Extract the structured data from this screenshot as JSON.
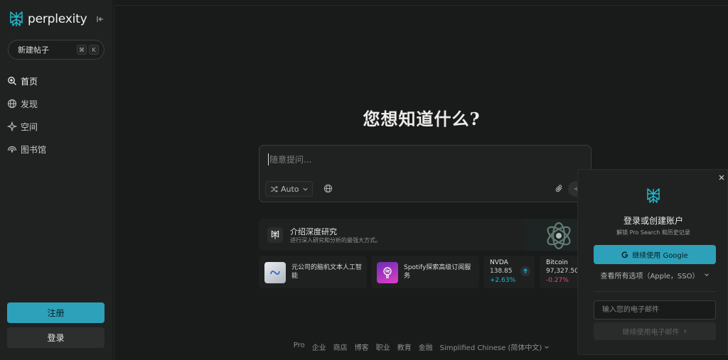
{
  "app": {
    "name": "perplexity"
  },
  "sidebar": {
    "new_thread": {
      "label": "新建帖子",
      "shortcut": [
        "⌘",
        "K"
      ]
    },
    "items": [
      {
        "label": "首页",
        "icon": "search-icon",
        "active": true
      },
      {
        "label": "发现",
        "icon": "globe-icon",
        "active": false
      },
      {
        "label": "空间",
        "icon": "spaces-icon",
        "active": false
      },
      {
        "label": "图书馆",
        "icon": "library-icon",
        "active": false
      }
    ],
    "signup_label": "注册",
    "login_label": "登录"
  },
  "main": {
    "headline": "您想知道什么?",
    "search": {
      "placeholder": "随意提问...",
      "mode_label": "Auto"
    },
    "promo": {
      "title": "介绍深度研究",
      "subtitle": "进行深入研究和分析的最强大方式。"
    },
    "cards": [
      {
        "text": "元公司的脑机文本人工智能"
      },
      {
        "text": "Spotify探索高级订阅服务"
      }
    ],
    "stocks": [
      {
        "name": "NVDA",
        "price": "138.85",
        "change": "+2.63%",
        "direction": "up"
      },
      {
        "name": "Bitcoin",
        "price": "97,327.50",
        "change": "-0.27%",
        "direction": "down"
      }
    ],
    "footer": {
      "links": [
        "Pro",
        "企业",
        "商店",
        "博客",
        "职业",
        "教育",
        "金融"
      ],
      "language": "Simplified Chinese (简体中文)"
    }
  },
  "modal": {
    "close_label": "×",
    "title": "登录或创建账户",
    "subtitle": "解锁 Pro Search 和历史记录",
    "google_label": "继续使用 Google",
    "all_options_label": "查看所有选项（Apple，SSO）",
    "email_placeholder": "输入您的电子邮件",
    "email_button_label": "继续使用电子邮件"
  },
  "colors": {
    "accent": "#2da1b9",
    "background": "#191a1a",
    "sidebar": "#202222",
    "positive": "#20b8cd",
    "negative": "#e04c72"
  }
}
